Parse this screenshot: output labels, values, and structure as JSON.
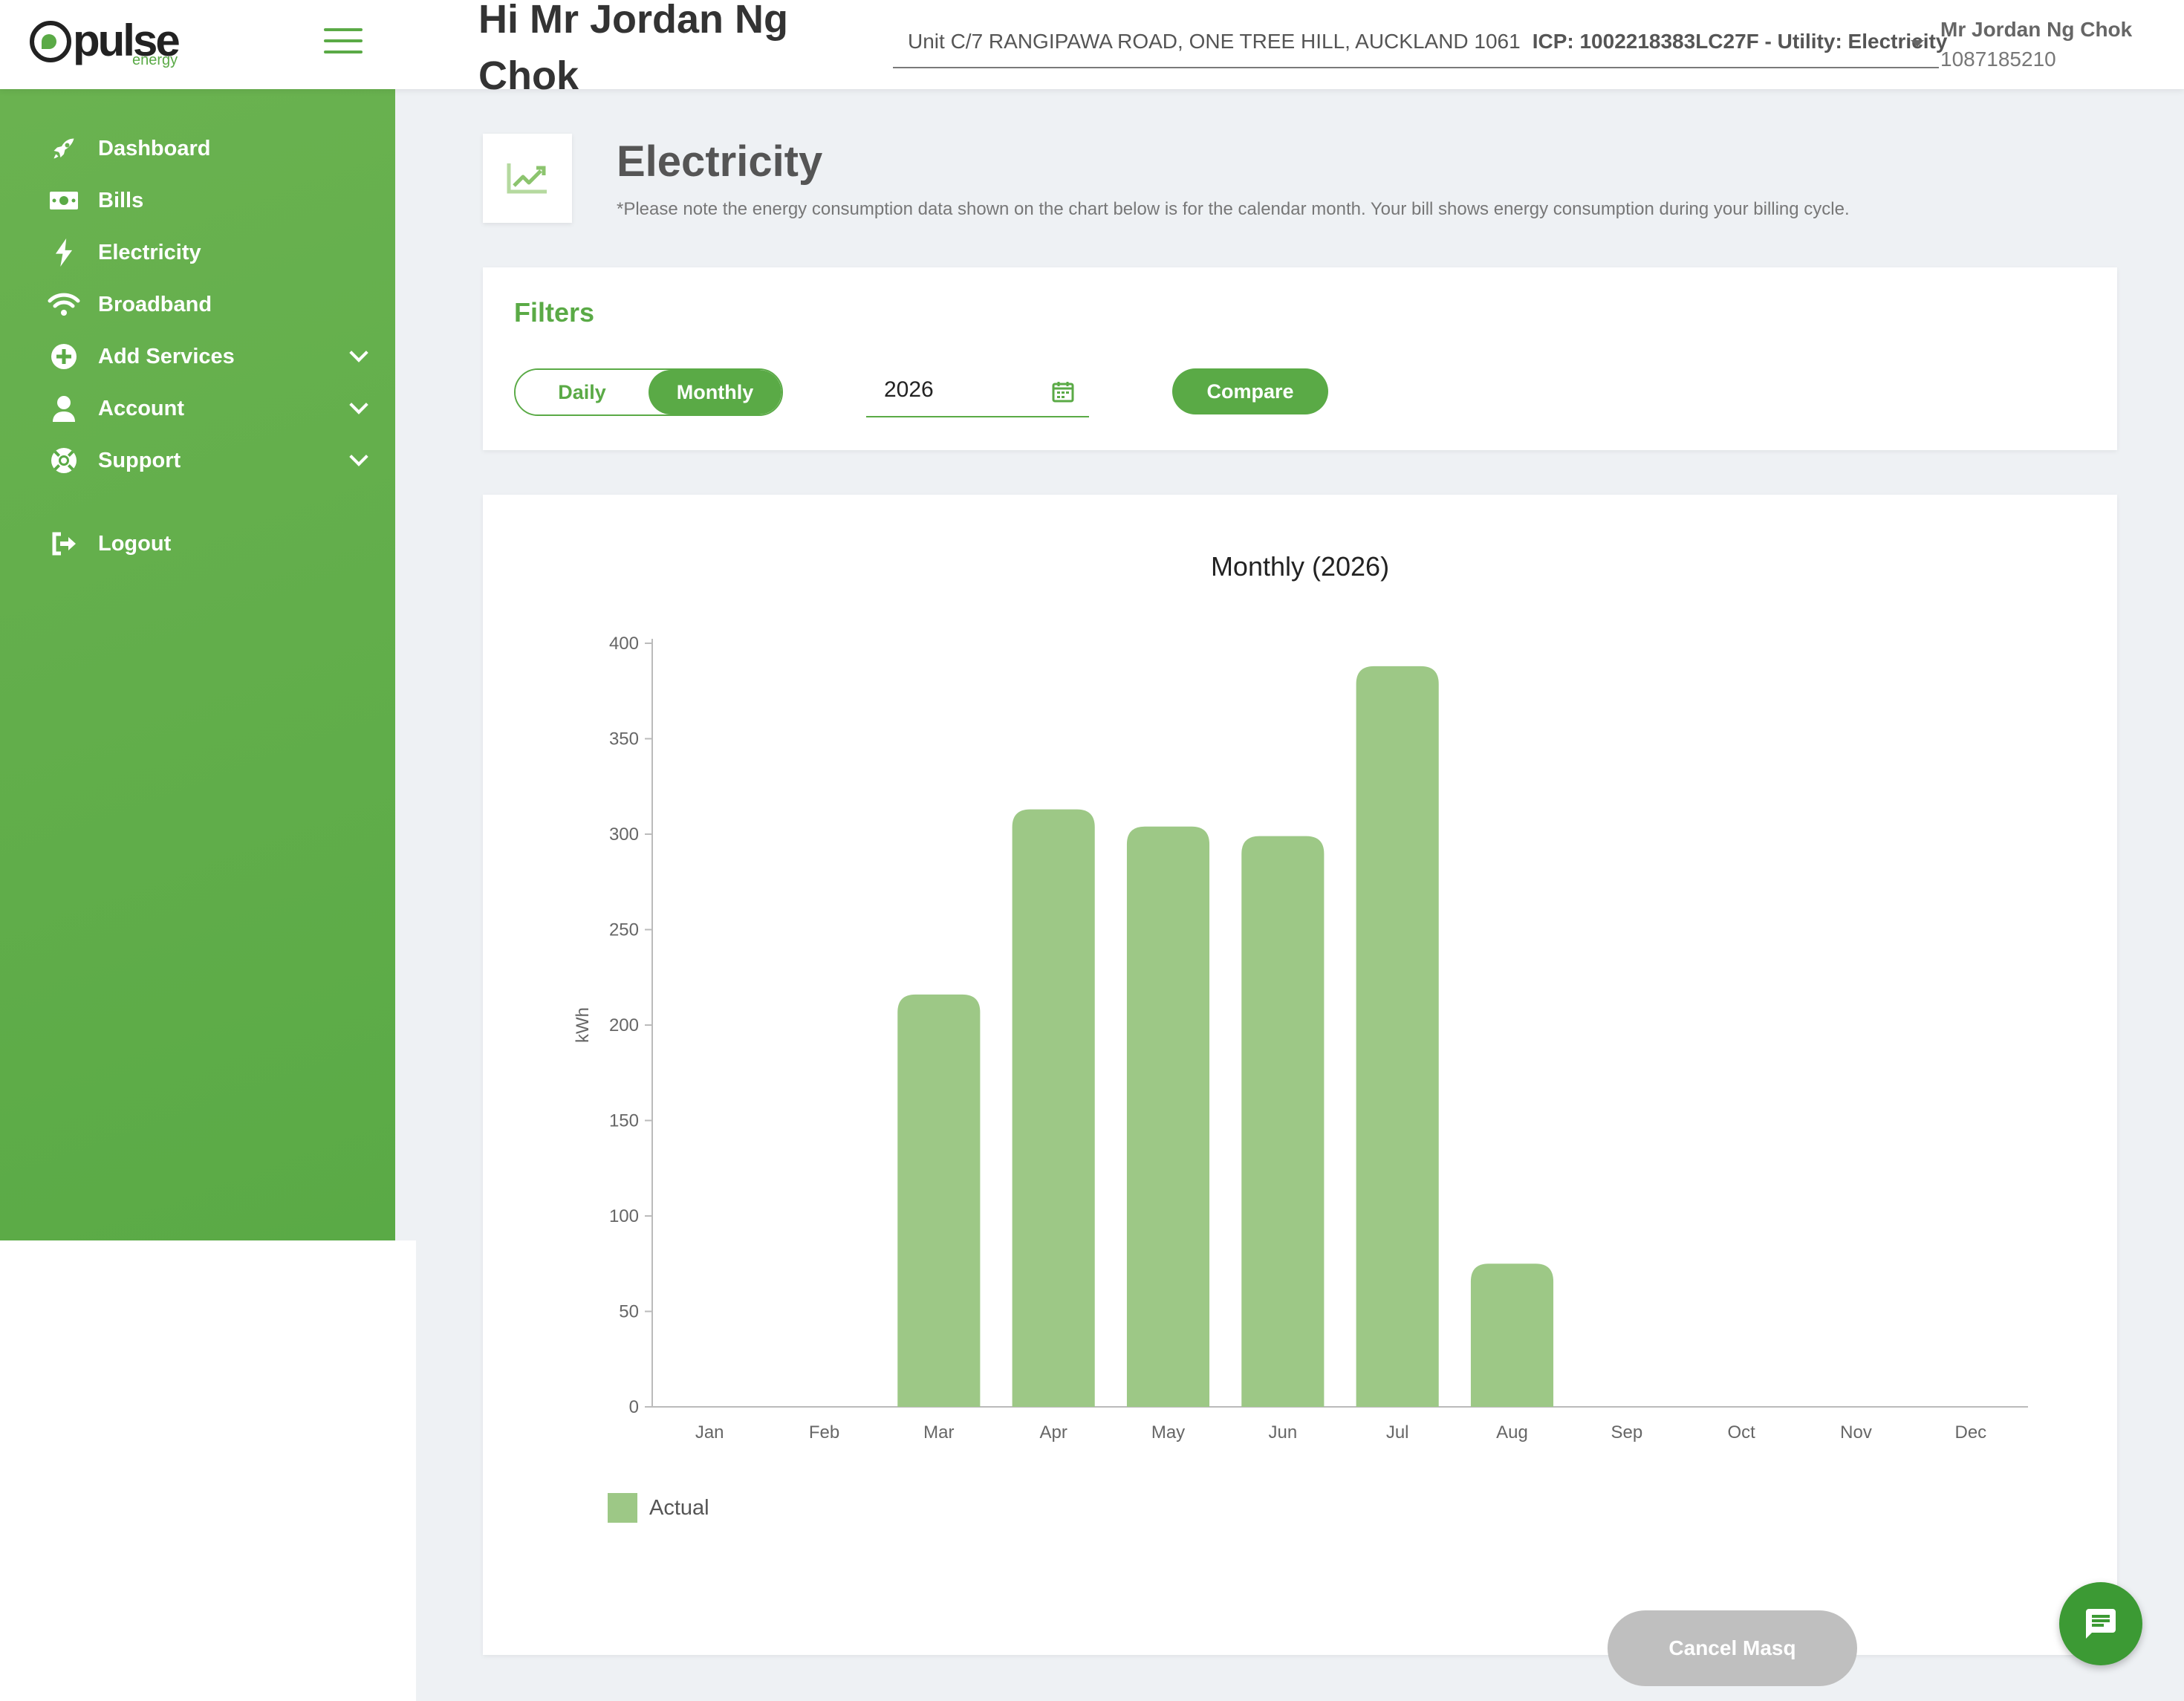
{
  "header": {
    "logo_text": "pulse",
    "logo_sub": "energy",
    "greeting": "Hi Mr Jordan Ng Chok",
    "address": "Unit C/7 RANGIPAWA ROAD, ONE TREE HILL, AUCKLAND 1061",
    "icp": "ICP: 1002218383LC27F - Utility: Electricity",
    "user_name": "Mr Jordan Ng Chok",
    "account_number": "1087185210"
  },
  "sidebar": {
    "items": [
      {
        "label": "Dashboard",
        "icon": "rocket-icon"
      },
      {
        "label": "Bills",
        "icon": "money-icon"
      },
      {
        "label": "Electricity",
        "icon": "bolt-icon"
      },
      {
        "label": "Broadband",
        "icon": "wifi-icon"
      },
      {
        "label": "Add Services",
        "icon": "plus-circle-icon"
      },
      {
        "label": "Account",
        "icon": "user-icon"
      },
      {
        "label": "Support",
        "icon": "lifebuoy-icon"
      },
      {
        "label": "Logout",
        "icon": "logout-icon"
      }
    ]
  },
  "page": {
    "title": "Electricity",
    "note": "*Please note the energy consumption data shown on the chart below is for the calendar month. Your bill shows energy consumption during your billing cycle."
  },
  "filters": {
    "title": "Filters",
    "daily_label": "Daily",
    "monthly_label": "Monthly",
    "selected": "Monthly",
    "year": "2026",
    "compare_label": "Compare"
  },
  "chart_data": {
    "type": "bar",
    "title": "Monthly  (2026)",
    "xlabel": "",
    "ylabel": "kWh",
    "ylim": [
      0,
      400
    ],
    "yticks": [
      0,
      50,
      100,
      150,
      200,
      250,
      300,
      350,
      400
    ],
    "categories": [
      "Jan",
      "Feb",
      "Mar",
      "Apr",
      "May",
      "Jun",
      "Jul",
      "Aug",
      "Sep",
      "Oct",
      "Nov",
      "Dec"
    ],
    "series": [
      {
        "name": "Actual",
        "color": "#9dc886",
        "values": [
          0,
          0,
          216,
          313,
          304,
          299,
          388,
          75,
          0,
          0,
          0,
          0
        ]
      }
    ],
    "legend": "bottom-left",
    "grid": false
  },
  "actions": {
    "cancel_masq": "Cancel Masq"
  },
  "colors": {
    "brand_green": "#5aaa46",
    "bar_green": "#9dc886"
  }
}
